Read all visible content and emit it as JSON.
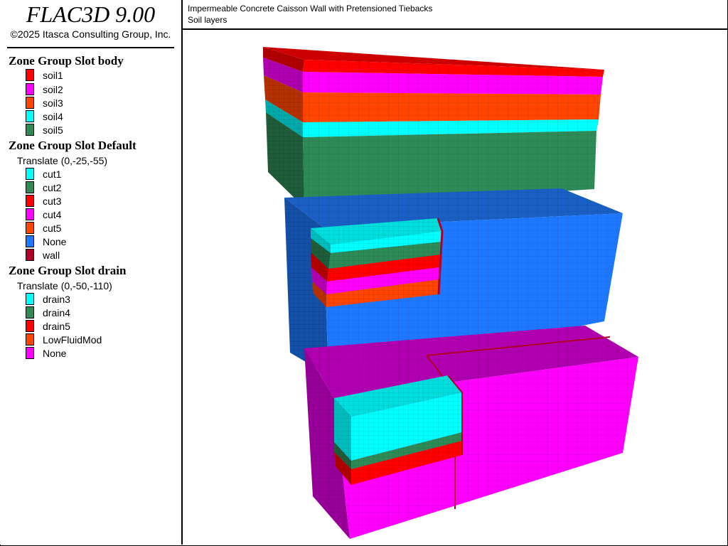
{
  "app": {
    "title": "FLAC3D 9.00",
    "copyright": "©2025 Itasca Consulting Group, Inc."
  },
  "header": {
    "line1": "Impermeable Concrete Caisson Wall with Pretensioned Tiebacks",
    "line2": "Soil layers"
  },
  "legend": {
    "groups": [
      {
        "title": "Zone Group Slot body",
        "translate": "",
        "items": [
          {
            "label": "soil1",
            "color": "#ff0000"
          },
          {
            "label": "soil2",
            "color": "#ff00ff"
          },
          {
            "label": "soil3",
            "color": "#ff4500"
          },
          {
            "label": "soil4",
            "color": "#00ffff"
          },
          {
            "label": "soil5",
            "color": "#2e8b57"
          }
        ]
      },
      {
        "title": "Zone Group Slot Default",
        "translate": "Translate (0,-25,-55)",
        "items": [
          {
            "label": "cut1",
            "color": "#00ffff"
          },
          {
            "label": "cut2",
            "color": "#2e8b57"
          },
          {
            "label": "cut3",
            "color": "#ff0000"
          },
          {
            "label": "cut4",
            "color": "#ff00ff"
          },
          {
            "label": "cut5",
            "color": "#ff4500"
          },
          {
            "label": "None",
            "color": "#1e78ff"
          },
          {
            "label": "wall",
            "color": "#b0002a"
          }
        ]
      },
      {
        "title": "Zone Group Slot drain",
        "translate": "Translate (0,-50,-110)",
        "items": [
          {
            "label": "drain3",
            "color": "#00ffff"
          },
          {
            "label": "drain4",
            "color": "#2e8b57"
          },
          {
            "label": "drain5",
            "color": "#ff0000"
          },
          {
            "label": "LowFluidMod",
            "color": "#ff4500"
          },
          {
            "label": "None",
            "color": "#ff00ff"
          }
        ]
      }
    ]
  }
}
